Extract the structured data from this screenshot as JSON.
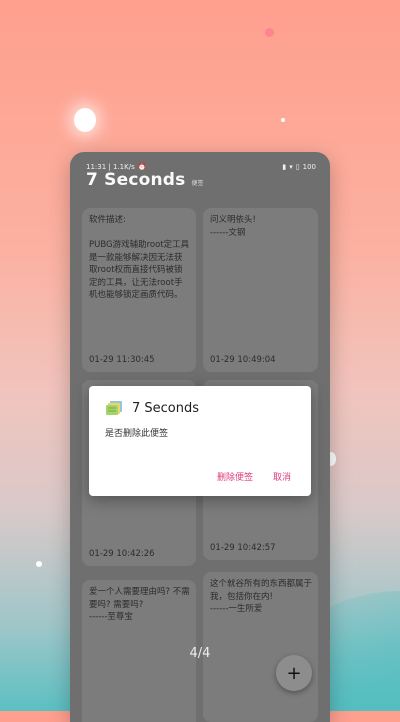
{
  "status": {
    "time_speed": "11:31 | 1.1K/s",
    "battery": "100"
  },
  "app": {
    "title": "7 Seconds",
    "subtitle": "便签"
  },
  "notes": [
    {
      "text": "软件描述:\n\nPUBG游戏辅助root定工具是一款能够解决因无法获取root权而直接代码被锁定的工具，让无法root手机也能够锁定画质代码。",
      "time": "01-29 11:30:45"
    },
    {
      "text": "问义明依头!\n------文钢",
      "time": "01-29 10:49:04"
    },
    {
      "text": "",
      "time": "01-29 10:42:26"
    },
    {
      "text": "",
      "time": "01-29 10:42:57"
    },
    {
      "text": "爱一个人需要理由吗? 不需要吗? 需要吗?\n------至尊宝",
      "time": ""
    },
    {
      "text": "这个就谷所有的东西都属于我，包括你在内!\n------一生所爱",
      "time": ""
    }
  ],
  "pager": {
    "text": "4/4"
  },
  "fab": {
    "label": "+"
  },
  "dialog": {
    "title": "7 Seconds",
    "message": "是否删除此便签",
    "delete_label": "删除便签",
    "cancel_label": "取消"
  },
  "colors": {
    "accent": "#e03a7a"
  }
}
